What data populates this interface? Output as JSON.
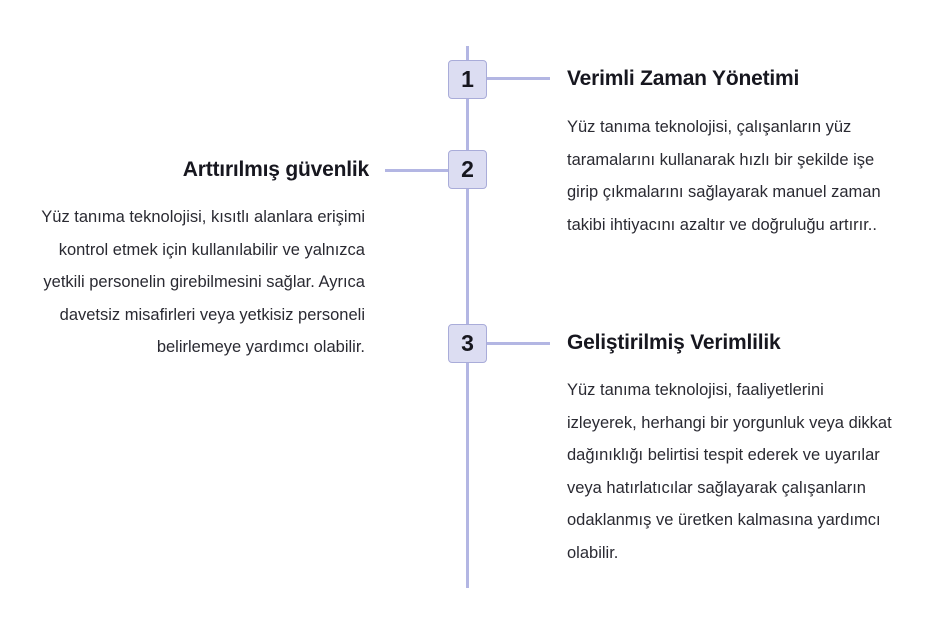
{
  "timeline": {
    "items": [
      {
        "number": "1",
        "title": "Verimli Zaman Yönetimi",
        "description": "Yüz tanıma teknolojisi, çalışanların yüz taramalarını kullanarak hızlı bir şekilde işe girip çıkmalarını sağlayarak manuel zaman takibi ihtiyacını azaltır ve doğruluğu artırır.."
      },
      {
        "number": "2",
        "title": "Arttırılmış güvenlik",
        "description": "Yüz tanıma teknolojisi, kısıtlı alanlara erişimi kontrol etmek için kullanılabilir ve yalnızca yetkili personelin girebilmesini sağlar. Ayrıca davetsiz misafirleri veya yetkisiz personeli belirlemeye yardımcı olabilir."
      },
      {
        "number": "3",
        "title": "Geliştirilmiş Verimlilik",
        "description": "Yüz tanıma teknolojisi, faaliyetlerini izleyerek, herhangi bir yorgunluk veya dikkat dağınıklığı belirtisi tespit ederek ve uyarılar veya hatırlatıcılar sağlayarak çalışanların odaklanmış ve üretken kalmasına yardımcı olabilir."
      }
    ]
  },
  "colors": {
    "line": "#b3b6e3",
    "node_fill": "#dcddf2",
    "node_border": "#a9acd9",
    "text": "#17171f"
  }
}
